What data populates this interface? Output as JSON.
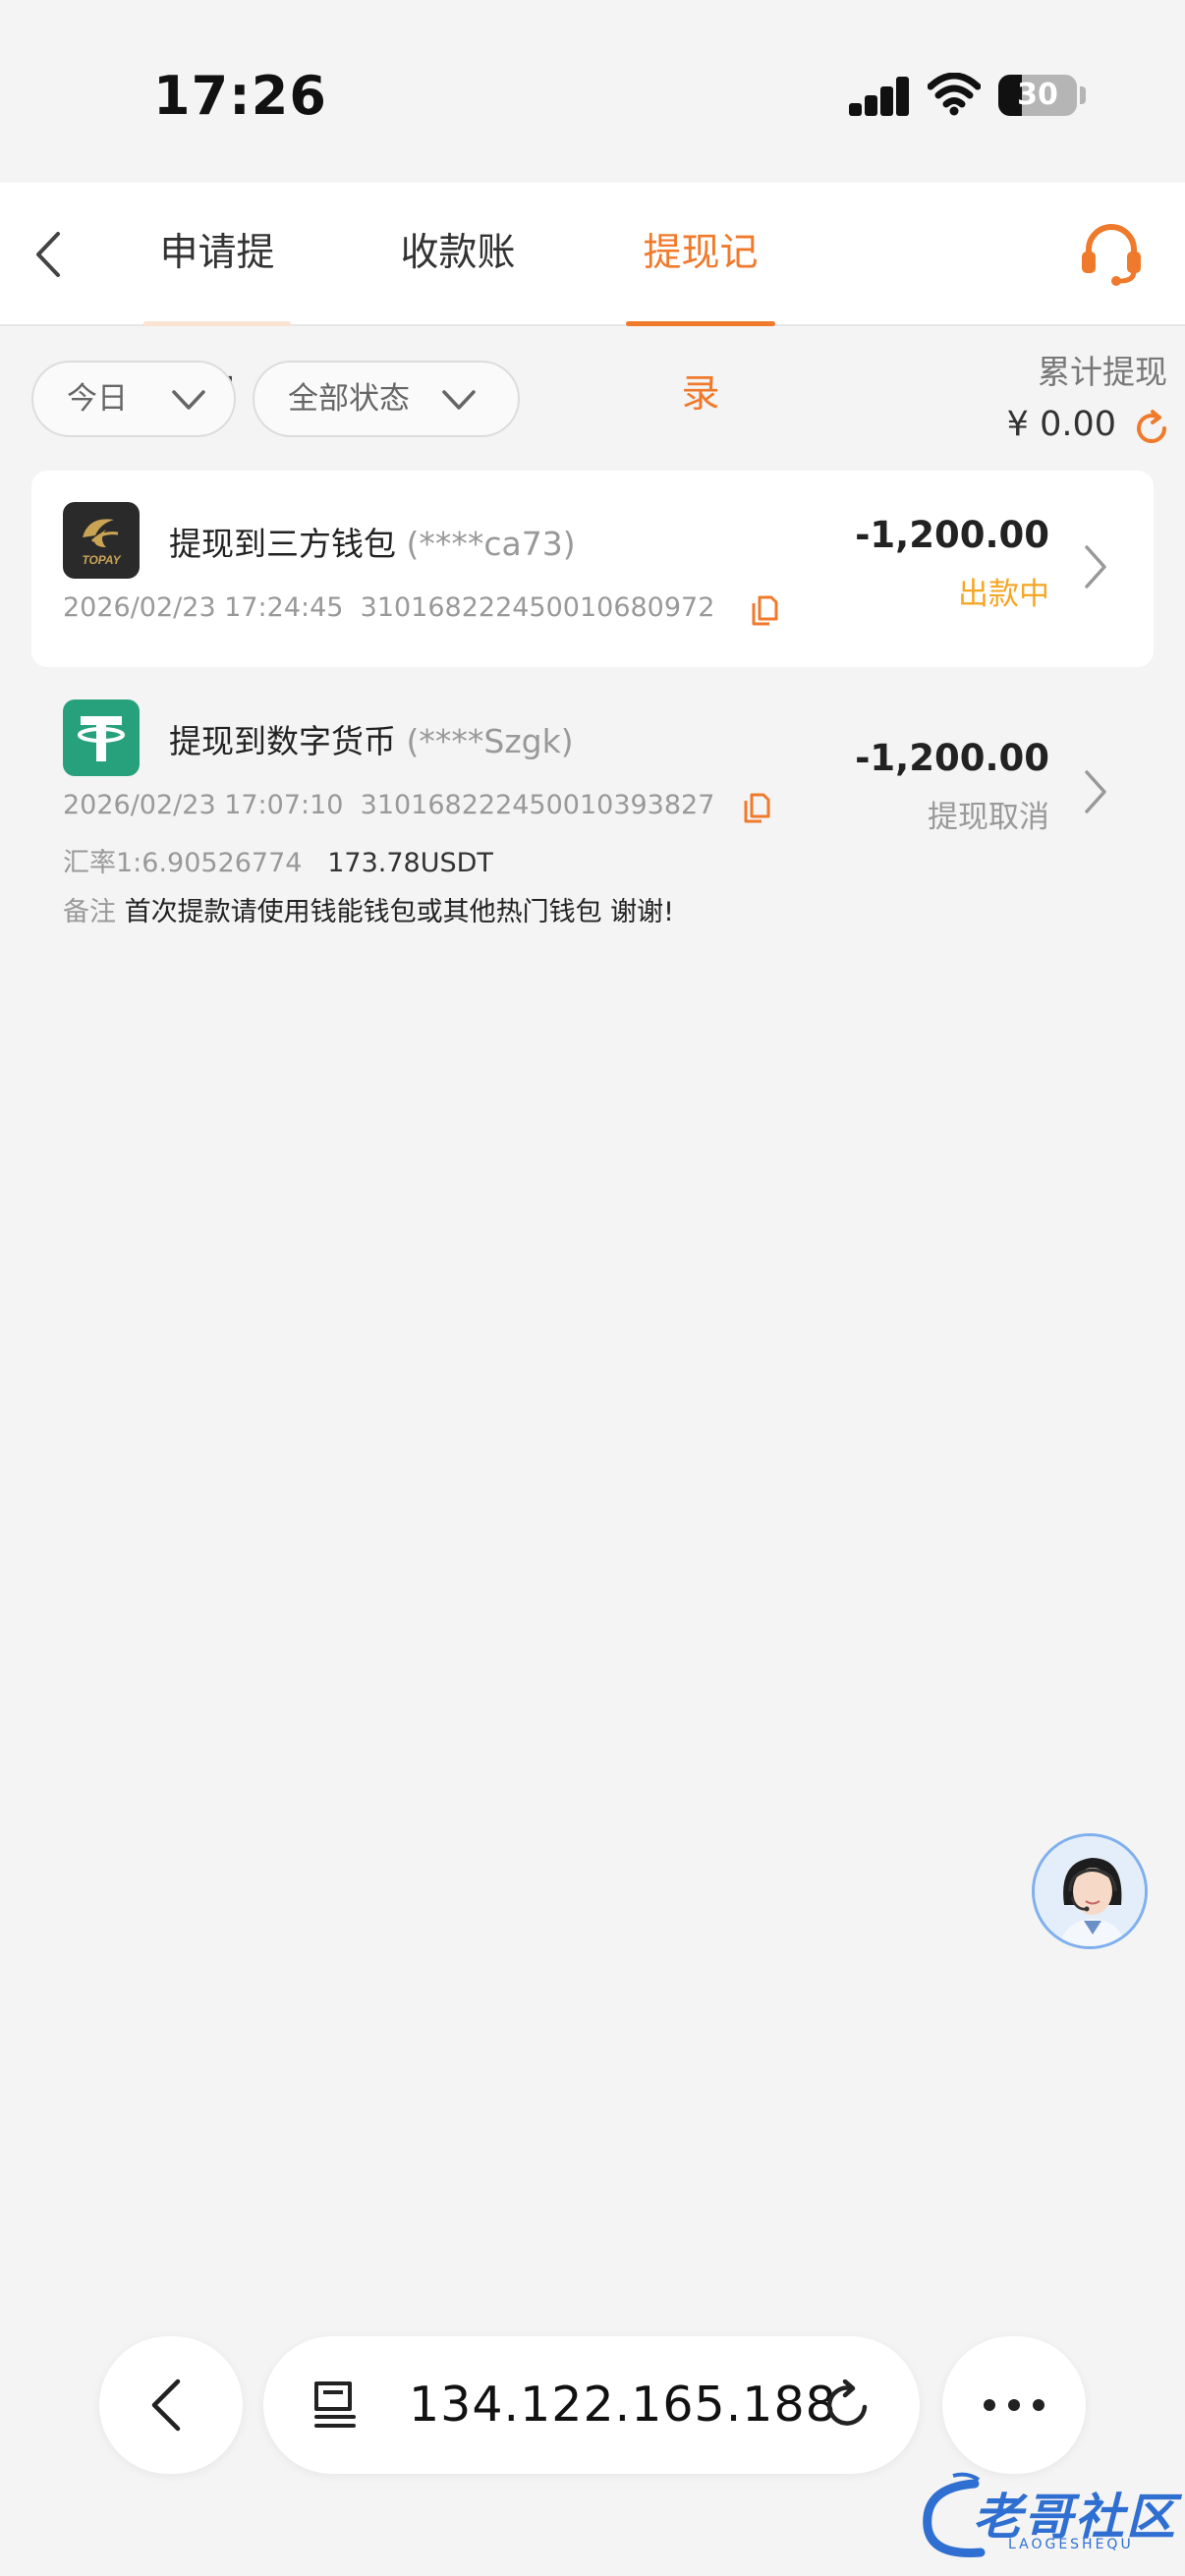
{
  "status_bar": {
    "time": "17:26",
    "battery_level": "30"
  },
  "header": {
    "tabs": [
      {
        "label": "申请提现",
        "active": false
      },
      {
        "label": "收款账户",
        "active": false
      },
      {
        "label": "提现记录",
        "active": true
      }
    ],
    "accent_color": "#f07a2c"
  },
  "filters": {
    "date": "今日",
    "status": "全部状态"
  },
  "summary": {
    "label": "累计提现",
    "value": "¥ 0.00"
  },
  "records": [
    {
      "title": "提现到三方钱包",
      "account": "(****ca73)",
      "datetime": "2026/02/23 17:24:45",
      "order_id": "310168222450010680972",
      "amount": "-1,200.00",
      "status": "出款中",
      "status_color": "#f5a623",
      "icon": "topay-wallet-icon",
      "icon_text": "TOPAY"
    },
    {
      "title": "提现到数字货币",
      "account": "(****Szgk)",
      "datetime": "2026/02/23 17:07:10",
      "order_id": "310168222450010393827",
      "amount": "-1,200.00",
      "status": "提现取消",
      "status_color": "#999999",
      "icon": "tether-usdt-icon",
      "rate_label": "汇率1:6.90526774",
      "usdt_amount": "173.78USDT",
      "note_label": "备注",
      "note_text": "首次提款请使用钱能钱包或其他热门钱包 谢谢!"
    }
  ],
  "browser": {
    "url": "134.122.165.188"
  },
  "watermark": {
    "text": "老哥社区",
    "sub": "LAOGESHEQU"
  }
}
